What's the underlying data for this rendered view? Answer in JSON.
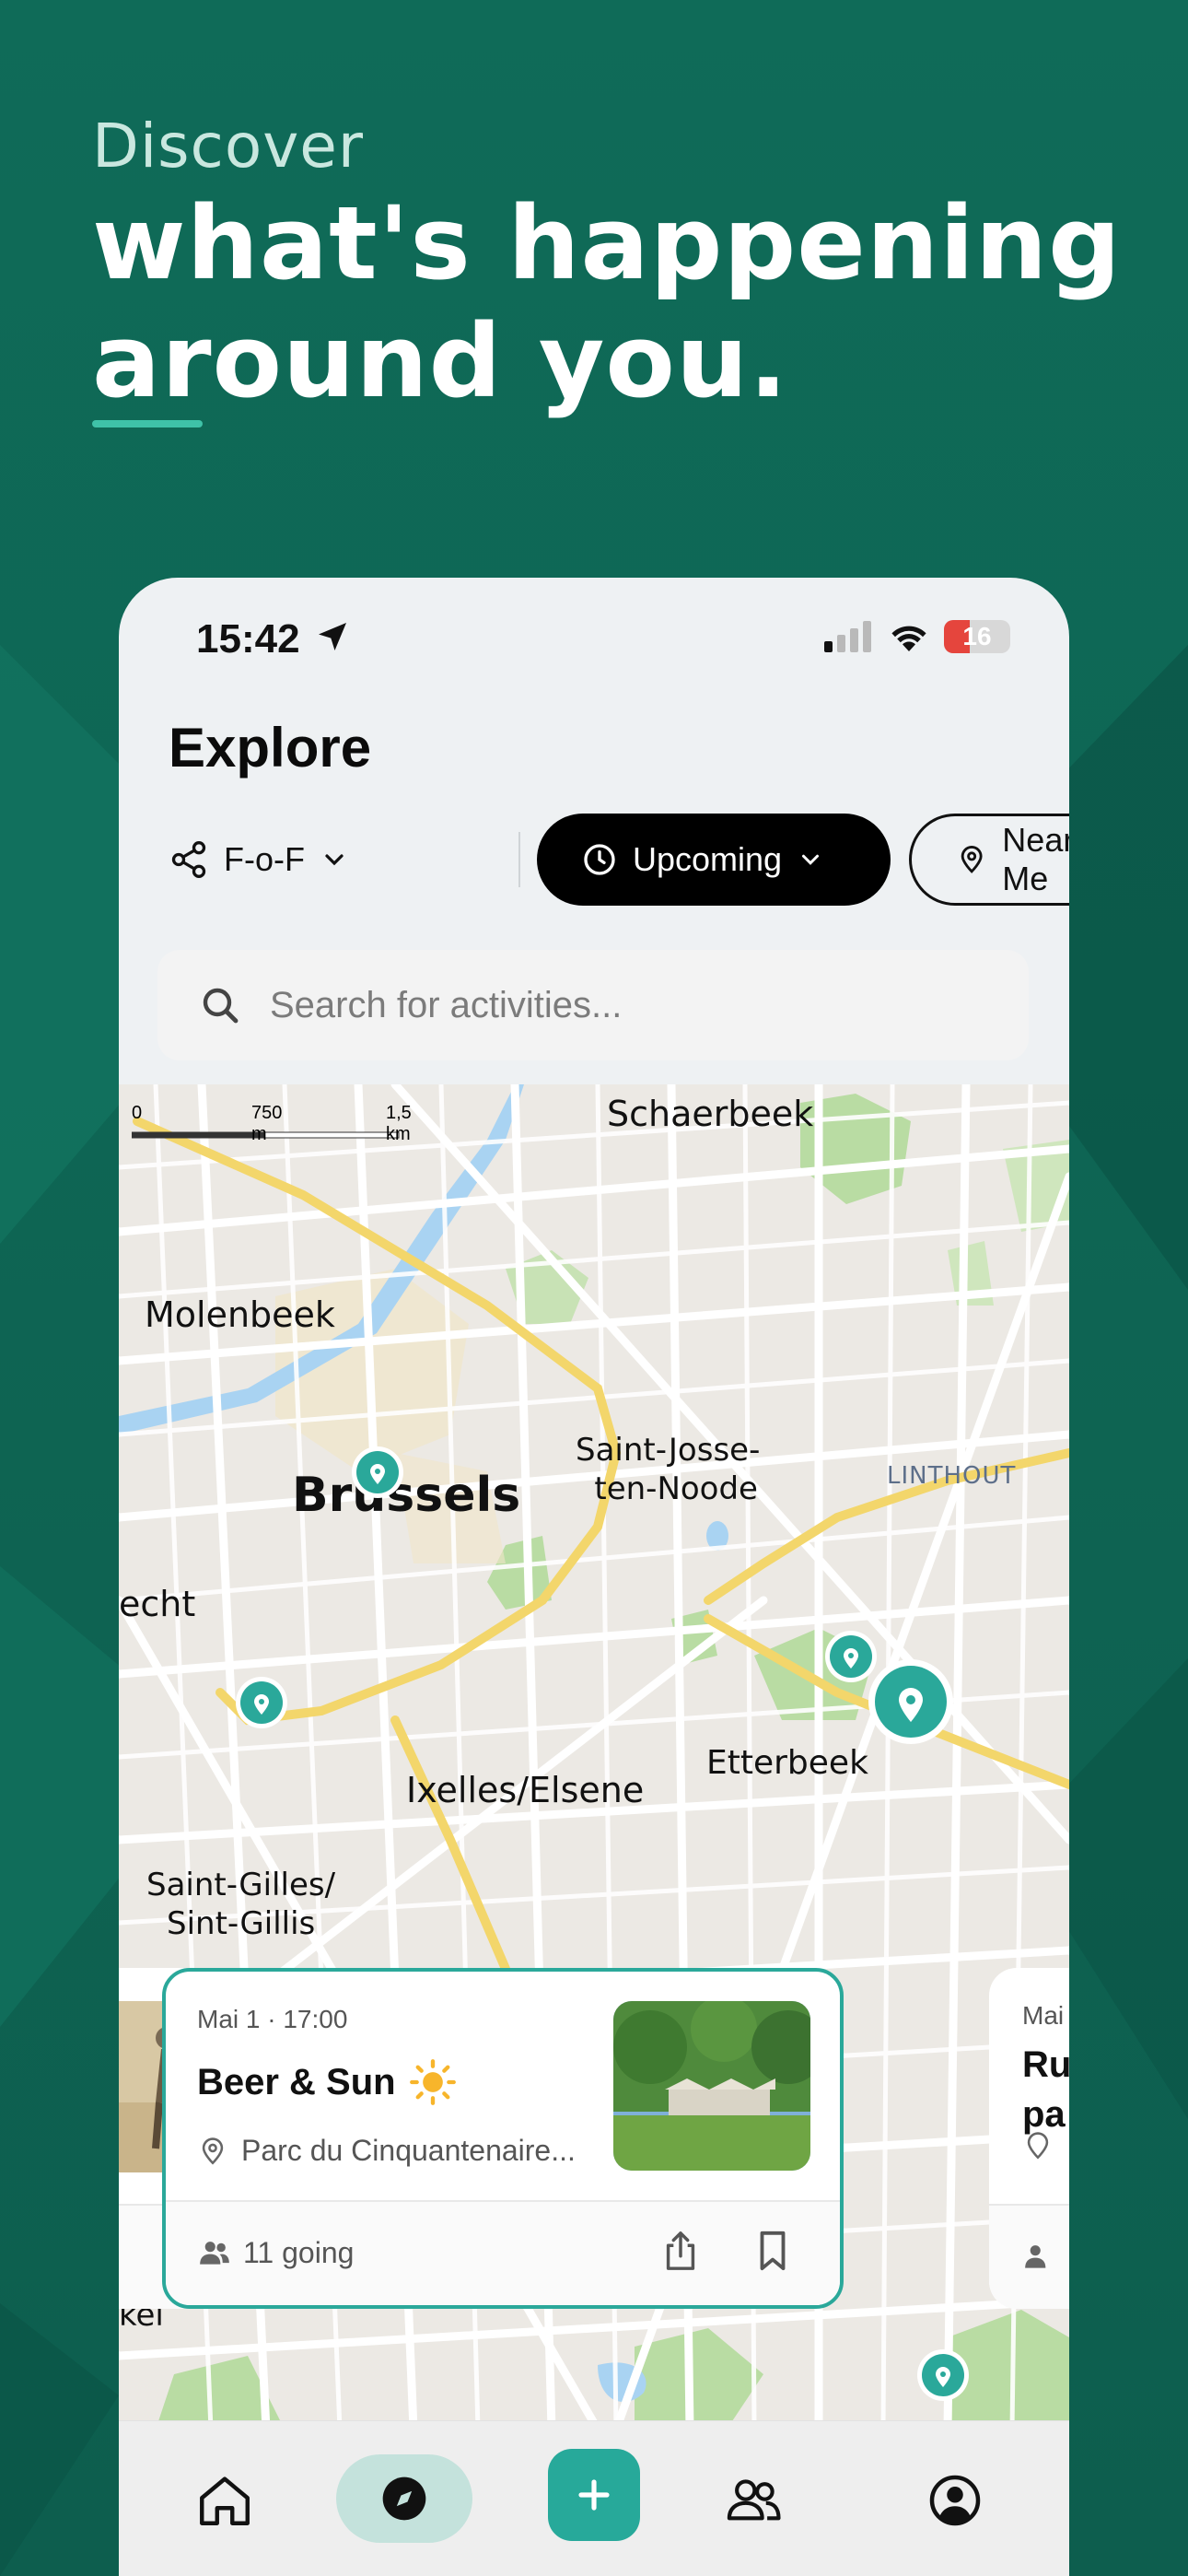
{
  "marketing": {
    "kicker": "Discover",
    "line1": "what's happening",
    "line2": "around you."
  },
  "status_bar": {
    "time": "15:42",
    "battery": "16"
  },
  "header": {
    "title": "Explore"
  },
  "filters": {
    "friends": "F-o-F",
    "time": "Upcoming",
    "location": "Near Me"
  },
  "search": {
    "placeholder": "Search for activities..."
  },
  "map": {
    "scale": {
      "zero": "0",
      "mid": "750 m",
      "end": "1,5 km"
    },
    "labels": {
      "schaerbeek": "Schaerbeek",
      "molenbeek": "Molenbeek",
      "brussels": "Brussels",
      "saint_josse_1": "Saint-Josse-",
      "saint_josse_2": "ten-Noode",
      "linthout": "LINTHOUT",
      "echt": "echt",
      "etterbeek": "Etterbeek",
      "ixelles": "Ixelles/Elsene",
      "saint_gilles_1": "Saint-Gilles/",
      "saint_gilles_2": "Sint-Gillis",
      "kel": "kel"
    }
  },
  "event_card": {
    "date": "Mai 1 · 17:00",
    "name": "Beer & Sun",
    "location": "Parc du Cinquantenaire...",
    "going": "11 going"
  },
  "next_card": {
    "date": "Mai",
    "title1": "Ru",
    "title2": "pa"
  },
  "colors": {
    "accent": "#2aa89a",
    "brand_bg": "#0f6b58",
    "highlight": "#3fc2a8"
  },
  "tabs": [
    "home-icon",
    "explore-icon",
    "add-icon",
    "friends-icon",
    "profile-icon"
  ]
}
